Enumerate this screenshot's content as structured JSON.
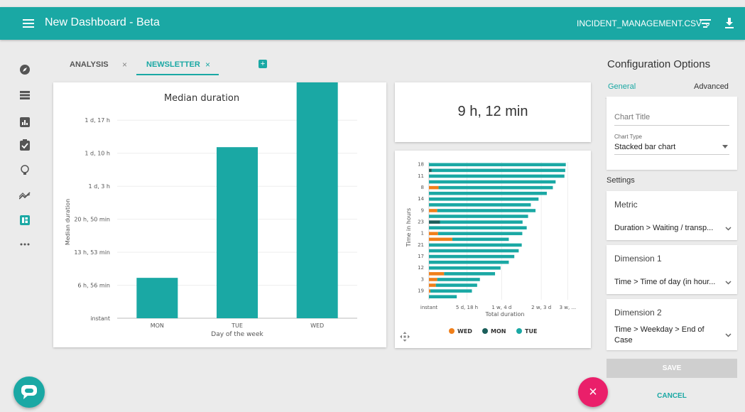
{
  "app": {
    "title": "New Dashboard - Beta",
    "file": "INCIDENT_MANAGEMENT.CSV",
    "file_chevron": "⌄"
  },
  "tabs": [
    {
      "label": "ANALYSIS",
      "close": "×"
    },
    {
      "label": "NEWSLETTER",
      "close": "×"
    }
  ],
  "add_tab": "+",
  "kpi": {
    "value": "9 h, 12 min"
  },
  "config": {
    "heading": "Configuration Options",
    "tab_general": "General",
    "tab_advanced": "Advanced",
    "chart_title_label": "Chart Title",
    "chart_type_label": "Chart Type",
    "chart_type_value": "Stacked bar chart",
    "settings": "Settings",
    "metric_label": "Metric",
    "metric_value": "Duration > Waiting / transp...",
    "dim1_label": "Dimension 1",
    "dim1_value": "Time > Time of day (in hour...",
    "dim2_label": "Dimension 2",
    "dim2_value_line1": "Time > Weekday > End of",
    "dim2_value_line2": "Case",
    "save": "SAVE",
    "cancel": "CANCEL"
  },
  "fab": "×",
  "colors": {
    "accent": "#1aa8a4",
    "wed": "#f07f1a",
    "mon": "#1b5e5a",
    "tue": "#1aa8a4",
    "fab": "#ea1f6a"
  },
  "icons": [
    "compass-icon",
    "list-icon",
    "bar-chart-icon",
    "clipboard-check-icon",
    "lightbulb-icon",
    "trend-icon",
    "dashboard-icon",
    "more-icon"
  ],
  "chart_data": [
    {
      "type": "bar",
      "title": "Median duration",
      "xlabel": "Day of the week",
      "ylabel": "Median duration",
      "categories": [
        "MON",
        "TUE",
        "WED"
      ],
      "values": [
        8.5,
        36.0,
        61.0
      ],
      "value_unit": "hours",
      "y_ticks": [
        {
          "label": "instant",
          "value": 0
        },
        {
          "label": "6 h, 56 min",
          "value": 6.93
        },
        {
          "label": "13 h, 53 min",
          "value": 13.88
        },
        {
          "label": "20 h, 50 min",
          "value": 20.83
        },
        {
          "label": "1 d, 3 h",
          "value": 27.77
        },
        {
          "label": "1 d, 10 h",
          "value": 34.72
        },
        {
          "label": "1 d, 17 h",
          "value": 41.67
        }
      ],
      "ylim": [
        0,
        43.5
      ],
      "grid": true
    },
    {
      "type": "bar",
      "orientation": "horizontal",
      "stacked": true,
      "xlabel": "Total duration",
      "ylabel": "Time in hours",
      "categories": [
        "18",
        "",
        "11",
        "",
        "8",
        "",
        "14",
        "",
        "9",
        "",
        "23",
        "",
        "1",
        "",
        "21",
        "",
        "17",
        "",
        "12",
        "",
        "3",
        "",
        "19",
        ""
      ],
      "x_ticks": [
        {
          "label": "instant",
          "value": 0
        },
        {
          "label": "5 d, 18 h",
          "value": 138
        },
        {
          "label": "1 w, 4 d",
          "value": 264
        },
        {
          "label": "2 w, 3 d",
          "value": 408
        },
        {
          "label": "3 w, ...",
          "value": 504
        }
      ],
      "xlim": [
        0,
        552
      ],
      "series": [
        {
          "name": "WED",
          "values": [
            0,
            0,
            0,
            0,
            35,
            0,
            0,
            0,
            30,
            0,
            0,
            0,
            33,
            85,
            0,
            0,
            0,
            0,
            0,
            55,
            30,
            25,
            5,
            0
          ]
        },
        {
          "name": "MON",
          "values": [
            0,
            10,
            0,
            0,
            0,
            0,
            0,
            0,
            0,
            0,
            40,
            0,
            0,
            0,
            0,
            0,
            0,
            0,
            0,
            0,
            0,
            0,
            0,
            0
          ]
        },
        {
          "name": "TUE",
          "values": [
            497,
            485,
            492,
            460,
            415,
            428,
            398,
            370,
            357,
            360,
            300,
            355,
            306,
            205,
            337,
            326,
            310,
            290,
            260,
            185,
            155,
            150,
            151,
            101
          ]
        }
      ],
      "grid": true,
      "legend": "bottom"
    }
  ]
}
